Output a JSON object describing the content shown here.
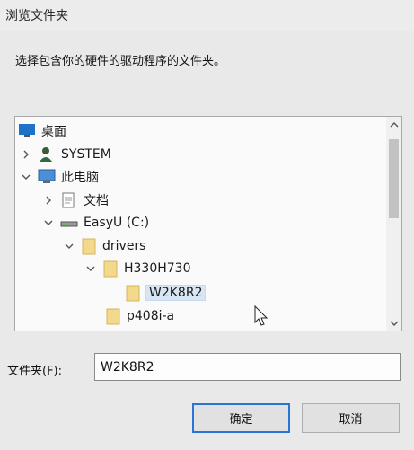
{
  "window": {
    "title": "浏览文件夹"
  },
  "instruction": "选择包含你的硬件的驱动程序的文件夹。",
  "tree": {
    "items": [
      {
        "label": "桌面"
      },
      {
        "label": "SYSTEM"
      },
      {
        "label": "此电脑"
      },
      {
        "label": "文档"
      },
      {
        "label": "EasyU (C:)"
      },
      {
        "label": "drivers"
      },
      {
        "label": "H330H730"
      },
      {
        "label": "W2K8R2"
      },
      {
        "label": "p408i-a"
      }
    ]
  },
  "folder_field": {
    "label": "文件夹(F):",
    "value": "W2K8R2"
  },
  "buttons": {
    "ok": "确定",
    "cancel": "取消"
  },
  "colors": {
    "accent": "#2b74d4",
    "selection": "#d8e6f3",
    "folder": "#f3d98b"
  }
}
